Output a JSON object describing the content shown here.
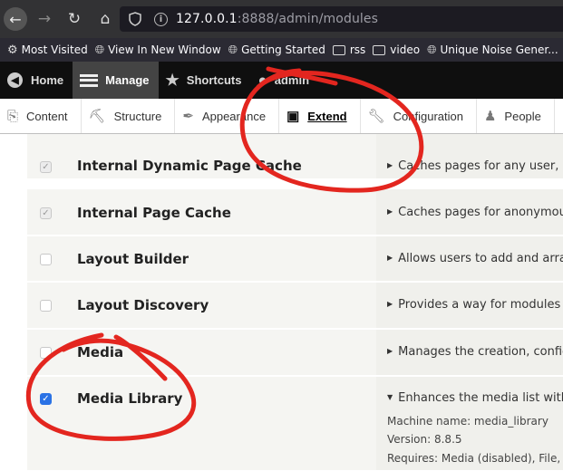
{
  "browser": {
    "url_host": "127.0.0.1",
    "url_rest": ":8888/admin/modules"
  },
  "bookmarks": [
    {
      "label": "Most Visited",
      "icon": "gear-icon"
    },
    {
      "label": "View In New Window",
      "icon": "globe-icon"
    },
    {
      "label": "Getting Started",
      "icon": "globe-icon"
    },
    {
      "label": "rss",
      "icon": "folder-icon"
    },
    {
      "label": "video",
      "icon": "folder-icon"
    },
    {
      "label": "Unique Noise Gener...",
      "icon": "globe-icon"
    }
  ],
  "toolbar": {
    "home": "Home",
    "manage": "Manage",
    "shortcuts": "Shortcuts",
    "user": "admin"
  },
  "tray": {
    "content": "Content",
    "structure": "Structure",
    "appearance": "Appearance",
    "extend": "Extend",
    "configuration": "Configuration",
    "people": "People"
  },
  "modules": [
    {
      "name": "Internal Dynamic Page Cache",
      "description": "Caches pages for any user, h",
      "state": "checked-disabled"
    },
    {
      "name": "Internal Page Cache",
      "description": "Caches pages for anonymou",
      "state": "checked-disabled"
    },
    {
      "name": "Layout Builder",
      "description": "Allows users to add and arra",
      "state": "unchecked"
    },
    {
      "name": "Layout Discovery",
      "description": "Provides a way for modules t",
      "state": "unchecked"
    },
    {
      "name": "Media",
      "description": "Manages the creation, config",
      "state": "unchecked"
    },
    {
      "name": "Media Library",
      "description": "Enhances the media list with",
      "state": "checked",
      "machine_name": "Machine name: media_library",
      "version": "Version: 8.8.5",
      "requires": "Requires: Media (disabled), File, Fi"
    }
  ],
  "colors": {
    "annotation": "#e3261f",
    "checkbox_checked": "#2a72e5",
    "toolbar": "#0f0f0f"
  }
}
